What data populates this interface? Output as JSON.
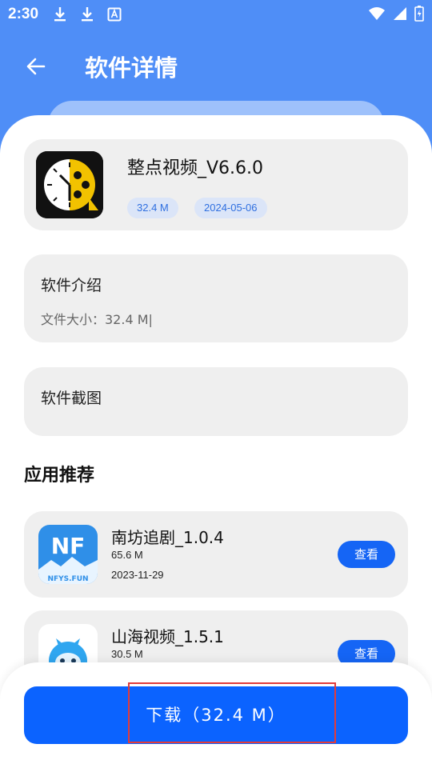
{
  "status_bar": {
    "time": "2:30",
    "left_icons": [
      "download-icon",
      "download-icon",
      "text-icon"
    ],
    "right_icons": [
      "wifi-icon",
      "signal-icon",
      "battery-icon"
    ]
  },
  "app_bar": {
    "title": "软件详情",
    "back_icon": "arrow-left-icon"
  },
  "app_info": {
    "name": "整点视频_V6.6.0",
    "size": "32.4 M",
    "date": "2024-05-06"
  },
  "intro": {
    "title": "软件介绍",
    "text": "文件大小：32.4 M|"
  },
  "screenshots": {
    "title": "软件截图"
  },
  "recommend": {
    "title": "应用推荐",
    "items": [
      {
        "name": "南坊追剧_1.0.4",
        "size": "65.6 M",
        "date": "2023-11-29",
        "button": "查看",
        "logo_text": "NF",
        "logo_sub": "NFYS.FUN"
      },
      {
        "name": "山海视频_1.5.1",
        "size": "30.5 M",
        "date": "",
        "button": "查看"
      }
    ]
  },
  "download": {
    "label": "下载（32.4 M）"
  },
  "colors": {
    "header_blue": "#4f8ef7",
    "button_blue": "#0b63ff",
    "tag_text": "#2f6fe0",
    "highlight_red": "#e23b3b"
  }
}
